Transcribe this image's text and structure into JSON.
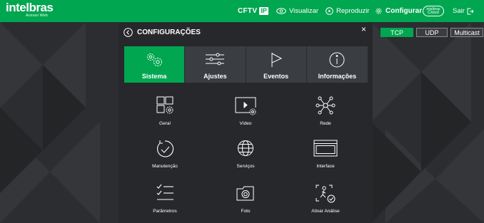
{
  "brand": {
    "name": "intelbras",
    "sub": "Acesso Web"
  },
  "topnav": {
    "cftv": "CFTV",
    "ip": "IP",
    "visualizar": "Visualizar",
    "reproduzir": "Reproduzir",
    "configurar": "Configurar",
    "cloud_line1": "intelbras",
    "cloud_line2": "Cloud",
    "sair": "Sair"
  },
  "protocols": [
    "TCP",
    "UDP",
    "Multicast"
  ],
  "panel": {
    "title": "CONFIGURAÇÕES",
    "close": "×",
    "tabs": [
      "Sistema",
      "Ajustes",
      "Eventos",
      "Informações"
    ],
    "items": [
      "Geral",
      "Vídeo",
      "Rede",
      "Manutenção",
      "Serviços",
      "Interface",
      "Parâmetros",
      "Foto",
      "Ativar Análise"
    ]
  },
  "colors": {
    "accent": "#00a650",
    "background": "#2a2c2f",
    "panel": "#26282b",
    "tab_inactive": "#3a3d41"
  }
}
